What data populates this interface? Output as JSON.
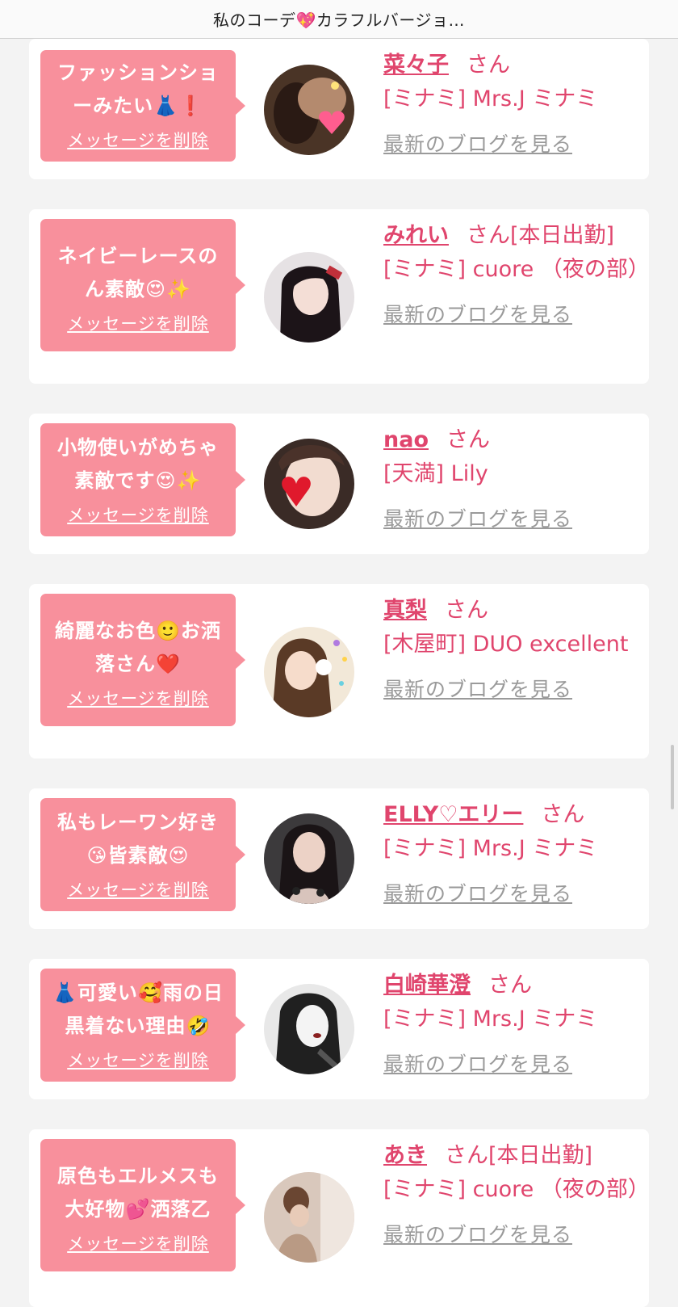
{
  "header": {
    "title": "私のコーデ💖カラフルバージョ…"
  },
  "items": [
    {
      "message": "ファッションショーみたい👗❗",
      "delete_label": "メッセージを削除",
      "name": "菜々子",
      "honorific": "さん",
      "status": "",
      "shop": "[ミナミ] Mrs.J ミナミ",
      "blog_link": "最新のブログを見る"
    },
    {
      "message": "ネイビーレースのん素敵😍✨",
      "delete_label": "メッセージを削除",
      "name": "みれい",
      "honorific": "さん",
      "status": "[本日出勤]",
      "shop": "[ミナミ] cuore （夜の部）",
      "blog_link": "最新のブログを見る"
    },
    {
      "message": "小物使いがめちゃ素敵です😍✨",
      "delete_label": "メッセージを削除",
      "name": "nao",
      "honorific": "さん",
      "status": "",
      "shop": "[天満] Lily",
      "blog_link": "最新のブログを見る"
    },
    {
      "message": "綺麗なお色🙂お洒落さん❤️",
      "delete_label": "メッセージを削除",
      "name": "真梨",
      "honorific": "さん",
      "status": "",
      "shop": "[木屋町] DUO excellent",
      "blog_link": "最新のブログを見る"
    },
    {
      "message": "私もレーワン好き😘皆素敵😍",
      "delete_label": "メッセージを削除",
      "name": "ELLY♡エリー",
      "honorific": "さん",
      "status": "",
      "shop": "[ミナミ] Mrs.J ミナミ",
      "blog_link": "最新のブログを見る"
    },
    {
      "message": "👗可愛い🥰雨の日黒着ない理由🤣",
      "delete_label": "メッセージを削除",
      "name": "白崎華澄",
      "honorific": "さん",
      "status": "",
      "shop": "[ミナミ] Mrs.J ミナミ",
      "blog_link": "最新のブログを見る"
    },
    {
      "message": "原色もエルメスも大好物💕洒落乙",
      "delete_label": "メッセージを削除",
      "name": "あき",
      "honorific": "さん",
      "status": "[本日出勤]",
      "shop": "[ミナミ] cuore （夜の部）",
      "blog_link": "最新のブログを見る"
    }
  ],
  "colors": {
    "accent": "#e0456d",
    "bubble": "#f8909c",
    "link_gray": "#9a9a9a",
    "background": "#f3f3f3"
  }
}
